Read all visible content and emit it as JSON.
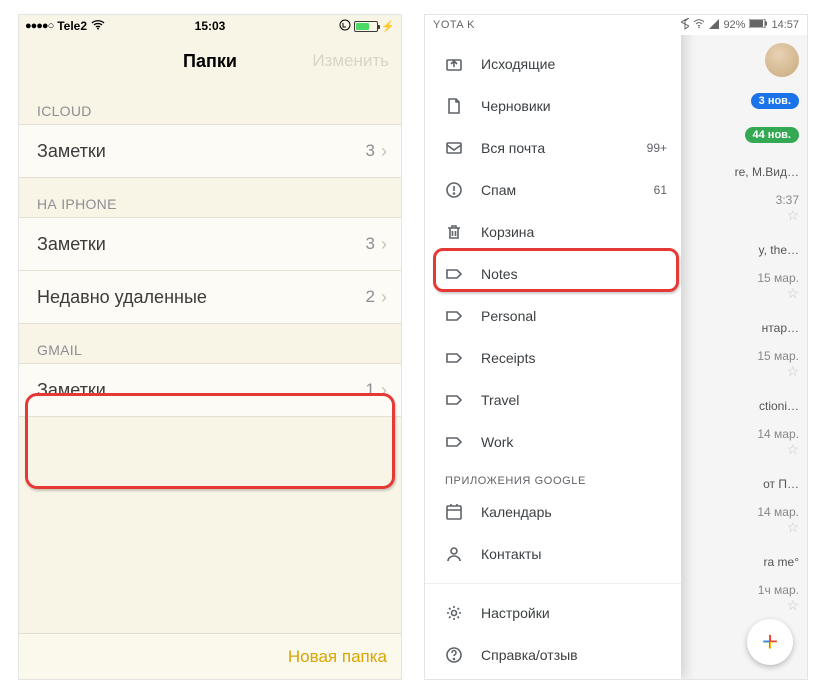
{
  "ios": {
    "status": {
      "carrier": "Tele2",
      "time": "15:03"
    },
    "title": "Папки",
    "edit_label": "Изменить",
    "sections": {
      "icloud": {
        "header": "ICLOUD",
        "rows": [
          {
            "label": "Заметки",
            "count": "3"
          }
        ]
      },
      "iphone": {
        "header": "НА IPHONE",
        "rows": [
          {
            "label": "Заметки",
            "count": "3"
          },
          {
            "label": "Недавно удаленные",
            "count": "2"
          }
        ]
      },
      "gmail": {
        "header": "GMAIL",
        "rows": [
          {
            "label": "Заметки",
            "count": "1"
          }
        ]
      }
    },
    "footer_label": "Новая папка"
  },
  "gmail": {
    "status": {
      "carrier": "YOTA K",
      "battery_pct": "92%",
      "time": "14:57"
    },
    "items": [
      {
        "icon": "outbox",
        "label": "Исходящие",
        "count": ""
      },
      {
        "icon": "file",
        "label": "Черновики",
        "count": ""
      },
      {
        "icon": "allmail",
        "label": "Вся почта",
        "count": "99+"
      },
      {
        "icon": "spam",
        "label": "Спам",
        "count": "61"
      },
      {
        "icon": "trash",
        "label": "Корзина",
        "count": ""
      },
      {
        "icon": "label",
        "label": "Notes",
        "count": ""
      },
      {
        "icon": "label",
        "label": "Personal",
        "count": ""
      },
      {
        "icon": "label",
        "label": "Receipts",
        "count": ""
      },
      {
        "icon": "label",
        "label": "Travel",
        "count": ""
      },
      {
        "icon": "label",
        "label": "Work",
        "count": ""
      }
    ],
    "apps_header": "ПРИЛОЖЕНИЯ GOOGLE",
    "apps": [
      {
        "icon": "calendar",
        "label": "Календарь"
      },
      {
        "icon": "contacts",
        "label": "Контакты"
      }
    ],
    "bottom": [
      {
        "icon": "settings",
        "label": "Настройки"
      },
      {
        "icon": "help",
        "label": "Справка/отзыв"
      }
    ],
    "peek": {
      "chips": [
        {
          "cls": "blue",
          "text": "3 нов."
        },
        {
          "cls": "green",
          "text": "44 нов."
        }
      ],
      "rows": [
        {
          "l1": "re, М.Вид…",
          "l2": "3:37"
        },
        {
          "l1": "y, the…",
          "l2": "15 мар."
        },
        {
          "l1": "нтар…",
          "l2": "15 мар."
        },
        {
          "l1": "ctioni…",
          "l2": "14 мар."
        },
        {
          "l1": "от П…",
          "l2": "14 мар."
        },
        {
          "l1": "ra me°",
          "l2": "1ч мар."
        }
      ]
    }
  }
}
